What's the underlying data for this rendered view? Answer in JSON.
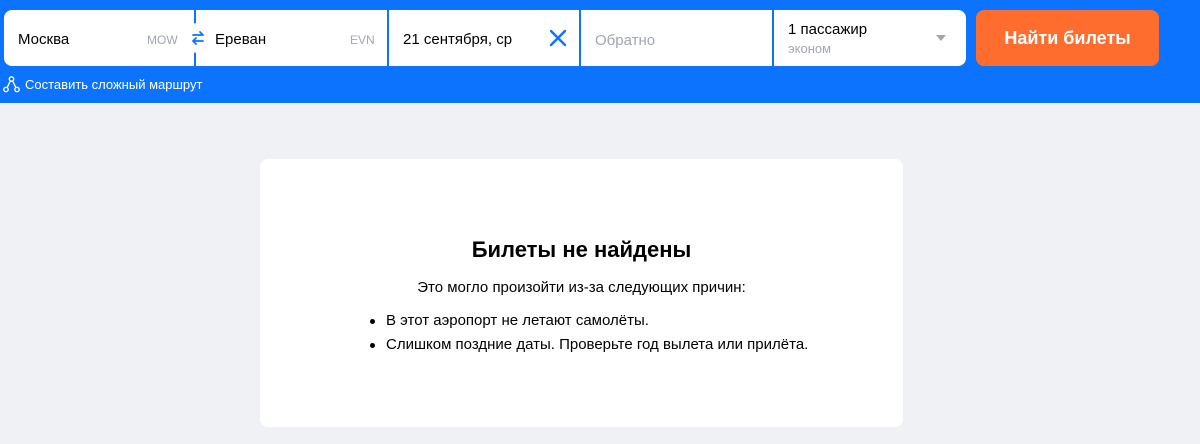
{
  "search": {
    "origin": {
      "city": "Москва",
      "code": "MOW"
    },
    "destination": {
      "city": "Ереван",
      "code": "EVN"
    },
    "depart_date": "21 сентября, ср",
    "return_placeholder": "Обратно",
    "passengers": {
      "count_label": "1 пассажир",
      "class_label": "эконом"
    },
    "submit_label": "Найти билеты",
    "complex_route_label": "Составить сложный маршрут"
  },
  "result": {
    "title": "Билеты не найдены",
    "subtitle": "Это могло произойти из-за следующих причин:",
    "reasons": [
      "В этот аэропорт не летают самолёты.",
      "Слишком поздние даты. Проверьте год вылета или прилёта."
    ]
  },
  "colors": {
    "brand_blue": "#0c73fe",
    "cta_orange": "#ff6d2e",
    "background": "#eff1f4"
  },
  "icons": {
    "swap": "swap-arrows-icon",
    "clear": "close-icon",
    "dropdown": "chevron-down-icon",
    "route": "route-nodes-icon"
  }
}
